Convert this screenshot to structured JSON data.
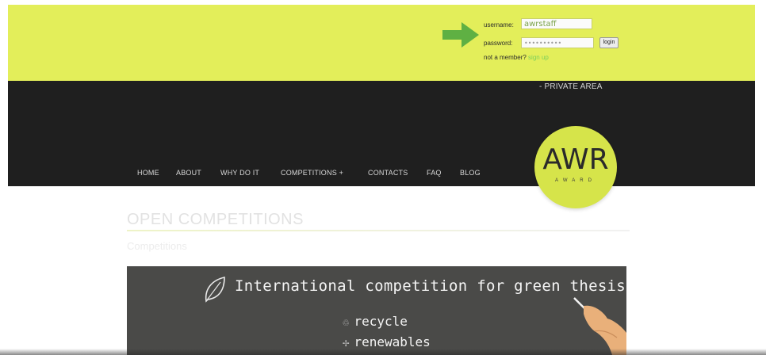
{
  "login": {
    "username_label": "username:",
    "username_value": "awrstaff",
    "password_label": "password:",
    "password_value": "••••••••••",
    "login_button": "login",
    "not_member_text": "not a member?",
    "signup_link": "sign up"
  },
  "header": {
    "private_area": "- PRIVATE AREA",
    "nav": [
      {
        "label": "HOME"
      },
      {
        "label": "ABOUT"
      },
      {
        "label": "WHY DO IT"
      },
      {
        "label": "COMPETITIONS +"
      },
      {
        "label": "CONTACTS"
      },
      {
        "label": "FAQ"
      },
      {
        "label": "BLOG"
      }
    ],
    "logo_text": "AWR",
    "logo_sub": "AWARD"
  },
  "content": {
    "title": "OPEN COMPETITIONS",
    "subtitle": "Competitions",
    "banner": {
      "title": "International competition for green thesis",
      "items": [
        {
          "label": "recycle",
          "icon": "recycle-icon"
        },
        {
          "label": "renewables",
          "icon": "wind-turbine-icon"
        }
      ]
    }
  },
  "colors": {
    "accent_yellow": "#e3ee5a",
    "dark_band": "#1f1f1f",
    "logo_green": "#d6e44a",
    "arrow_green": "#5fb043"
  }
}
